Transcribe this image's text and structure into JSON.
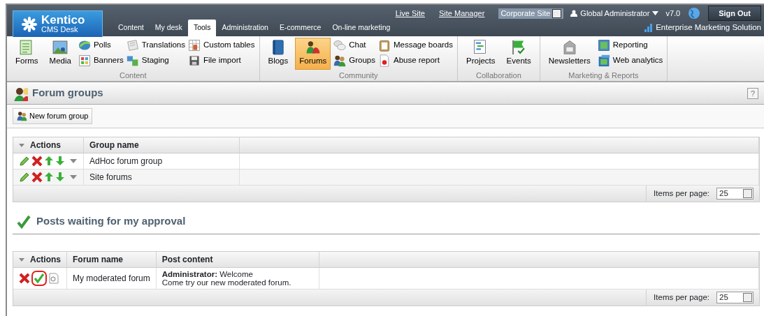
{
  "header": {
    "logo": {
      "name": "Kentico",
      "subtitle": "CMS Desk"
    },
    "tabs": [
      {
        "label": "Content",
        "selected": false
      },
      {
        "label": "My desk",
        "selected": false
      },
      {
        "label": "Tools",
        "selected": true
      },
      {
        "label": "Administration",
        "selected": false
      },
      {
        "label": "E-commerce",
        "selected": false
      },
      {
        "label": "On-line marketing",
        "selected": false
      }
    ],
    "links": [
      "Live Site",
      "Site Manager"
    ],
    "site_select": {
      "value": "Corporate Site"
    },
    "user": "Global Administrator",
    "version": "v7.0",
    "sign_out": "Sign Out",
    "edition": "Enterprise Marketing Solution"
  },
  "ribbon": [
    {
      "title": "Content",
      "items": [
        {
          "label": "Forms",
          "kind": "large",
          "selected": false
        },
        {
          "label": "Media",
          "kind": "large",
          "selected": false
        },
        {
          "label": "Polls",
          "kind": "small",
          "selected": false
        },
        {
          "label": "Banners",
          "kind": "small",
          "selected": false
        },
        {
          "label": "Translations",
          "kind": "small",
          "selected": false
        },
        {
          "label": "Staging",
          "kind": "small",
          "selected": false
        },
        {
          "label": "Custom tables",
          "kind": "small",
          "selected": false
        },
        {
          "label": "File import",
          "kind": "small",
          "selected": false
        }
      ]
    },
    {
      "title": "Community",
      "items": [
        {
          "label": "Blogs",
          "kind": "large",
          "selected": false
        },
        {
          "label": "Forums",
          "kind": "large",
          "selected": true
        },
        {
          "label": "Chat",
          "kind": "small",
          "selected": false
        },
        {
          "label": "Groups",
          "kind": "small",
          "selected": false
        },
        {
          "label": "Message boards",
          "kind": "small",
          "selected": false
        },
        {
          "label": "Abuse report",
          "kind": "small",
          "selected": false
        }
      ]
    },
    {
      "title": "Collaboration",
      "items": [
        {
          "label": "Projects",
          "kind": "large",
          "selected": false
        },
        {
          "label": "Events",
          "kind": "large",
          "selected": false
        }
      ]
    },
    {
      "title": "Marketing & Reports",
      "items": [
        {
          "label": "Newsletters",
          "kind": "large",
          "selected": false
        },
        {
          "label": "Reporting",
          "kind": "small",
          "selected": false
        },
        {
          "label": "Web analytics",
          "kind": "small",
          "selected": false
        }
      ]
    }
  ],
  "page_title": "Forum groups",
  "help": "?",
  "toolbar": {
    "button": "New forum group"
  },
  "groups_table": {
    "columns": [
      "Actions",
      "Group name"
    ],
    "rows": [
      {
        "group_name": "AdHoc forum group"
      },
      {
        "group_name": "Site forums"
      }
    ],
    "pager": {
      "label": "Items per page:",
      "value": "25"
    }
  },
  "approval": {
    "title": "Posts waiting for my approval",
    "table": {
      "columns": [
        "Actions",
        "Forum name",
        "Post content"
      ],
      "rows": [
        {
          "actions": [
            {
              "kind": "reject",
              "highlighted": false
            },
            {
              "kind": "approve",
              "highlighted": true
            },
            {
              "kind": "view",
              "highlighted": false
            }
          ],
          "forum_name": "My moderated forum",
          "post_heading": "**Administrator:** Welcome",
          "post_text": "Come try our new moderated forum."
        }
      ],
      "pager": {
        "label": "Items per page:",
        "value": "25"
      }
    }
  }
}
